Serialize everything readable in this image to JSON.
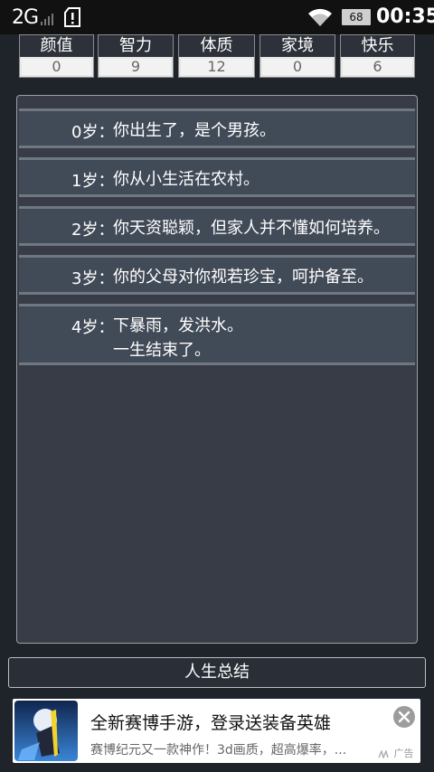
{
  "status_bar": {
    "network": "2G",
    "battery": "68",
    "time": "00:35",
    "icons": [
      "signal-icon",
      "alert-icon",
      "wifi-icon",
      "battery-icon"
    ]
  },
  "stats": [
    {
      "label": "颜值",
      "value": "0"
    },
    {
      "label": "智力",
      "value": "9"
    },
    {
      "label": "体质",
      "value": "12"
    },
    {
      "label": "家境",
      "value": "0"
    },
    {
      "label": "快乐",
      "value": "6"
    }
  ],
  "log": [
    {
      "age": "0岁：",
      "text": "你出生了，是个男孩。"
    },
    {
      "age": "1岁：",
      "text": "你从小生活在农村。"
    },
    {
      "age": "2岁：",
      "text": "你天资聪颖，但家人并不懂如何培养。"
    },
    {
      "age": "3岁：",
      "text": "你的父母对你视若珍宝，呵护备至。"
    },
    {
      "age": "4岁：",
      "text": "下暴雨，发洪水。",
      "text2": "一生结束了。"
    }
  ],
  "summary_button": "人生总结",
  "ad": {
    "title": "全新赛博手游，登录送装备英雄",
    "description": "赛博纪元又一款神作！3d画质，超高爆率，...",
    "label": "广告",
    "icon": "close-icon"
  },
  "colors": {
    "background": "#1f232a",
    "stat_header": "#2d323a",
    "log_row": "#414a57",
    "panel": "#373c46"
  }
}
